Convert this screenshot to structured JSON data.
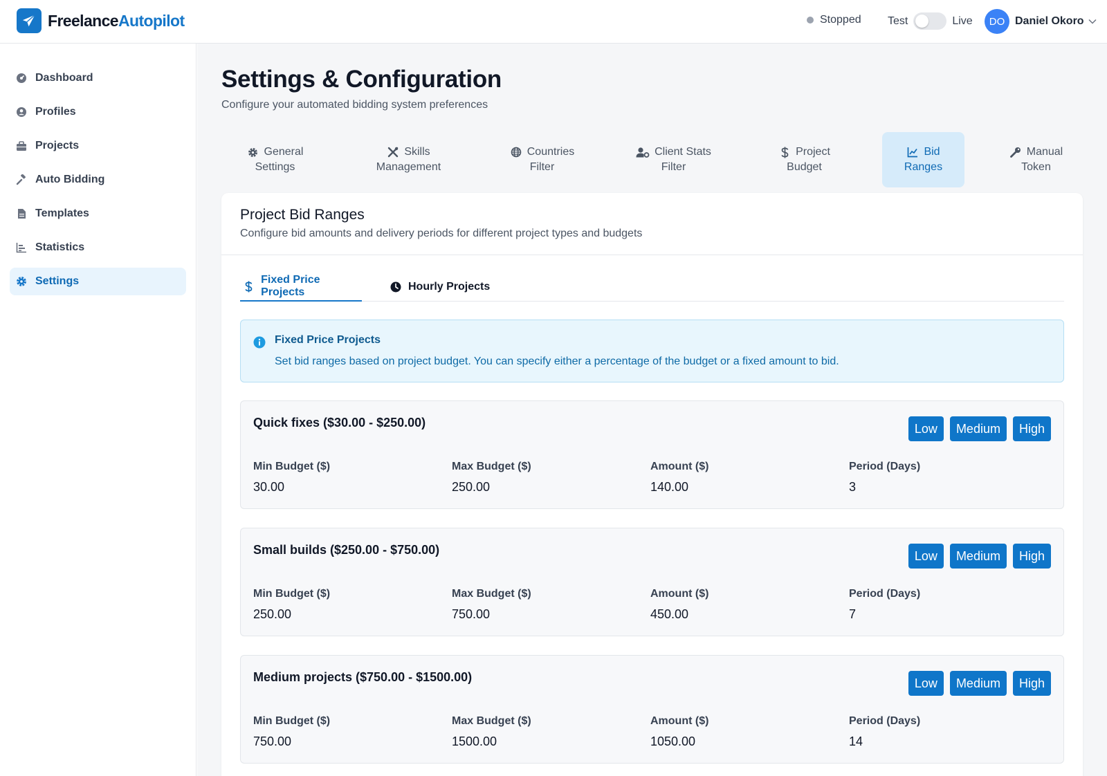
{
  "app": {
    "brand_part1": "Freelance",
    "brand_part2": "Autopilot",
    "brand_color": "#1677c9"
  },
  "header": {
    "status_label": "Stopped",
    "mode_test": "Test",
    "mode_live": "Live",
    "mode_is_live": false,
    "user_initials": "DO",
    "user_name": "Daniel Okoro"
  },
  "sidebar": {
    "items": [
      {
        "label": "Dashboard",
        "icon": "dashboard-icon",
        "active": false
      },
      {
        "label": "Profiles",
        "icon": "user-circle-icon",
        "active": false
      },
      {
        "label": "Projects",
        "icon": "briefcase-icon",
        "active": false
      },
      {
        "label": "Auto Bidding",
        "icon": "gavel-icon",
        "active": false
      },
      {
        "label": "Templates",
        "icon": "document-icon",
        "active": false
      },
      {
        "label": "Statistics",
        "icon": "bar-chart-icon",
        "active": false
      },
      {
        "label": "Settings",
        "icon": "gear-icon",
        "active": true
      }
    ]
  },
  "page": {
    "title": "Settings & Configuration",
    "subtitle": "Configure your automated bidding system preferences"
  },
  "tabs": [
    {
      "line1": "General",
      "line2": "Settings",
      "icon": "gear-icon",
      "active": false
    },
    {
      "line1": "Skills",
      "line2": "Management",
      "icon": "tools-icon",
      "active": false
    },
    {
      "line1": "Countries",
      "line2": "Filter",
      "icon": "globe-icon",
      "active": false
    },
    {
      "line1": "Client Stats",
      "line2": "Filter",
      "icon": "user-cog-icon",
      "active": false
    },
    {
      "line1": "Project",
      "line2": "Budget",
      "icon": "dollar-icon",
      "active": false
    },
    {
      "line1": "Bid",
      "line2": "Ranges",
      "icon": "line-chart-icon",
      "active": true
    },
    {
      "line1": "Manual",
      "line2": "Token",
      "icon": "key-icon",
      "active": false
    }
  ],
  "card": {
    "title": "Project Bid Ranges",
    "subtitle": "Configure bid amounts and delivery periods for different project types and budgets"
  },
  "subtabs": [
    {
      "label": "Fixed Price Projects",
      "icon": "dollar-icon",
      "active": true
    },
    {
      "label": "Hourly Projects",
      "icon": "clock-icon",
      "active": false
    }
  ],
  "info": {
    "title": "Fixed Price Projects",
    "text": "Set bid ranges based on project budget. You can specify either a percentage of the budget or a fixed amount to bid."
  },
  "level_buttons": [
    "Low",
    "Medium",
    "High"
  ],
  "field_labels": {
    "min": "Min Budget ($)",
    "max": "Max Budget ($)",
    "amount": "Amount ($)",
    "period": "Period (Days)"
  },
  "ranges": [
    {
      "title": "Quick fixes ($30.00 - $250.00)",
      "min": "30.00",
      "max": "250.00",
      "amount": "140.00",
      "period": "3"
    },
    {
      "title": "Small builds ($250.00 - $750.00)",
      "min": "250.00",
      "max": "750.00",
      "amount": "450.00",
      "period": "7"
    },
    {
      "title": "Medium projects ($750.00 - $1500.00)",
      "min": "750.00",
      "max": "1500.00",
      "amount": "1050.00",
      "period": "14"
    }
  ]
}
